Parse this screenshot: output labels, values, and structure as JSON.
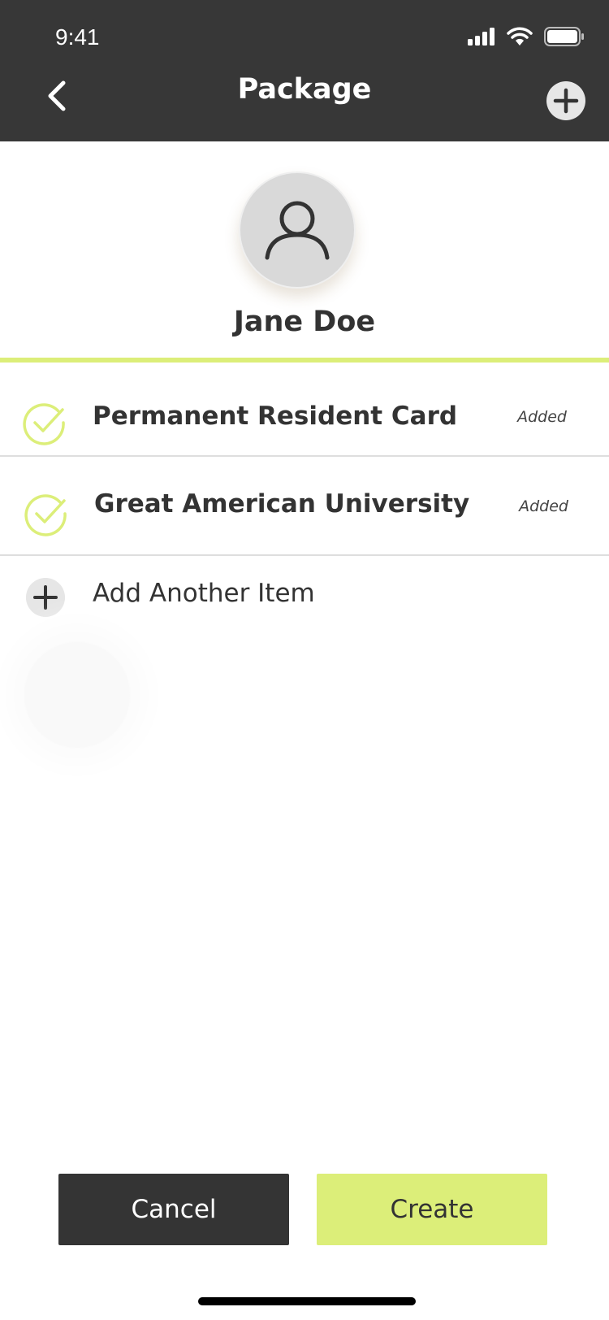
{
  "status_bar": {
    "time": "9:41",
    "icons": [
      "signal-icon",
      "wifi-icon",
      "battery-icon"
    ]
  },
  "header": {
    "title": "Package",
    "back_icon": "chevron-left-icon",
    "add_icon": "plus-circle-icon"
  },
  "profile": {
    "name": "Jane Doe",
    "avatar_icon": "user-icon"
  },
  "items": [
    {
      "label": "Permanent Resident Card",
      "status": "Added",
      "icon": "check-circle-icon"
    },
    {
      "label": "Great American University",
      "status": "Added",
      "icon": "check-circle-icon"
    }
  ],
  "add_item": {
    "label": "Add Another Item",
    "icon": "plus-icon"
  },
  "actions": {
    "cancel_label": "Cancel",
    "create_label": "Create"
  },
  "colors": {
    "header_bg": "#373737",
    "accent": "#dcee79",
    "dark_button": "#343434",
    "text": "#333333"
  }
}
